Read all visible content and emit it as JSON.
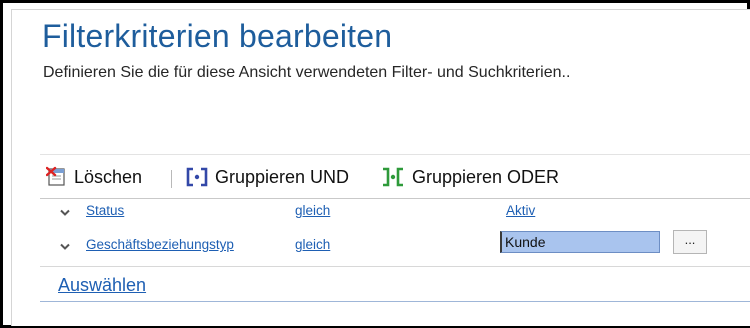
{
  "header": {
    "title": "Filterkriterien bearbeiten",
    "subtitle": "Definieren Sie die für diese Ansicht verwendeten Filter- und Suchkriterien.."
  },
  "toolbar": {
    "delete_label": "Löschen",
    "group_and_label": "Gruppieren UND",
    "group_or_label": "Gruppieren ODER"
  },
  "criteria": [
    {
      "field": "Status",
      "operator": "gleich",
      "value": "Aktiv"
    },
    {
      "field": "Geschäftsbeziehungstyp",
      "operator": "gleich",
      "value": "Kunde",
      "lookup_button": "..."
    }
  ],
  "footer": {
    "select_label": "Auswählen"
  },
  "colors": {
    "title": "#1e5d9c",
    "link": "#1e5fb3",
    "selected_value_bg": "#a9c4ee"
  }
}
